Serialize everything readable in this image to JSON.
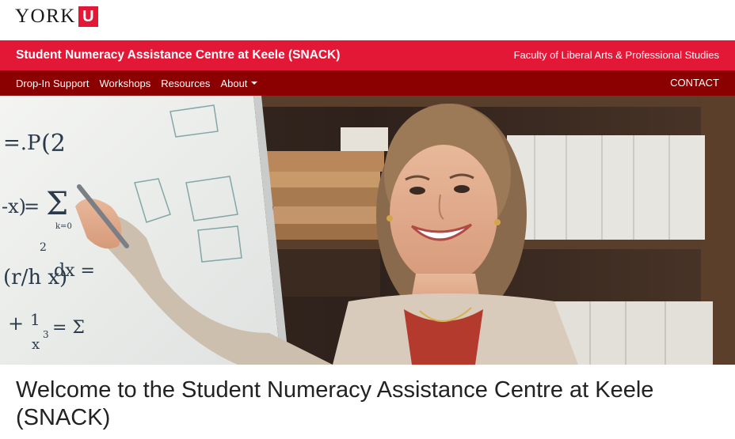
{
  "brand": {
    "wordmark": "YORK",
    "mark": "U",
    "accent": "#e31837",
    "nav_bg": "#8b0000"
  },
  "header": {
    "site_title": "Student Numeracy Assistance Centre at Keele (SNACK)",
    "faculty_link": "Faculty of Liberal Arts & Professional Studies"
  },
  "nav": {
    "items": [
      {
        "label": "Drop-In Support"
      },
      {
        "label": "Workshops"
      },
      {
        "label": "Resources"
      },
      {
        "label": "About",
        "has_dropdown": true
      }
    ],
    "contact_label": "CONTACT"
  },
  "hero": {
    "whiteboard_math": [
      "=.P",
      "(2",
      "-x)",
      "=",
      "Σ",
      "k=0",
      "(r/h x)",
      "2",
      "dx =",
      "+",
      "1",
      "x",
      "3",
      "= Σ"
    ]
  },
  "main": {
    "heading": "Welcome to the Student Numeracy Assistance Centre at Keele (SNACK)"
  }
}
